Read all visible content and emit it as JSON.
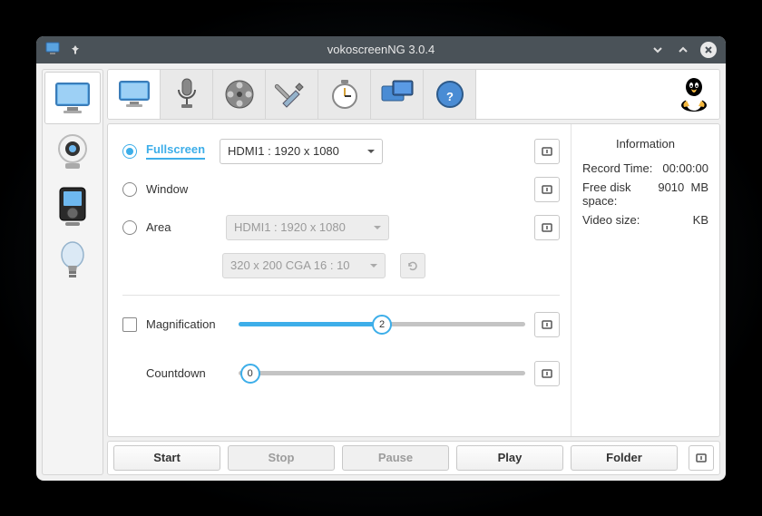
{
  "window": {
    "title": "vokoscreenNG 3.0.4"
  },
  "screen": {
    "fullscreen_label": "Fullscreen",
    "window_label": "Window",
    "area_label": "Area",
    "display_select": "HDMI1 :  1920 x 1080",
    "area_display_select": "HDMI1 :  1920 x 1080",
    "area_preset_select": "320 x 200 CGA 16 : 10",
    "magnification_label": "Magnification",
    "magnification_value": "2",
    "countdown_label": "Countdown",
    "countdown_value": "0"
  },
  "info": {
    "heading": "Information",
    "record_time_label": "Record Time:",
    "record_time_value": "00:00:00",
    "free_space_label": "Free disk space:",
    "free_space_value": "9010",
    "free_space_unit": "MB",
    "video_size_label": "Video size:",
    "video_size_unit": "KB"
  },
  "buttons": {
    "start": "Start",
    "stop": "Stop",
    "pause": "Pause",
    "play": "Play",
    "folder": "Folder"
  }
}
